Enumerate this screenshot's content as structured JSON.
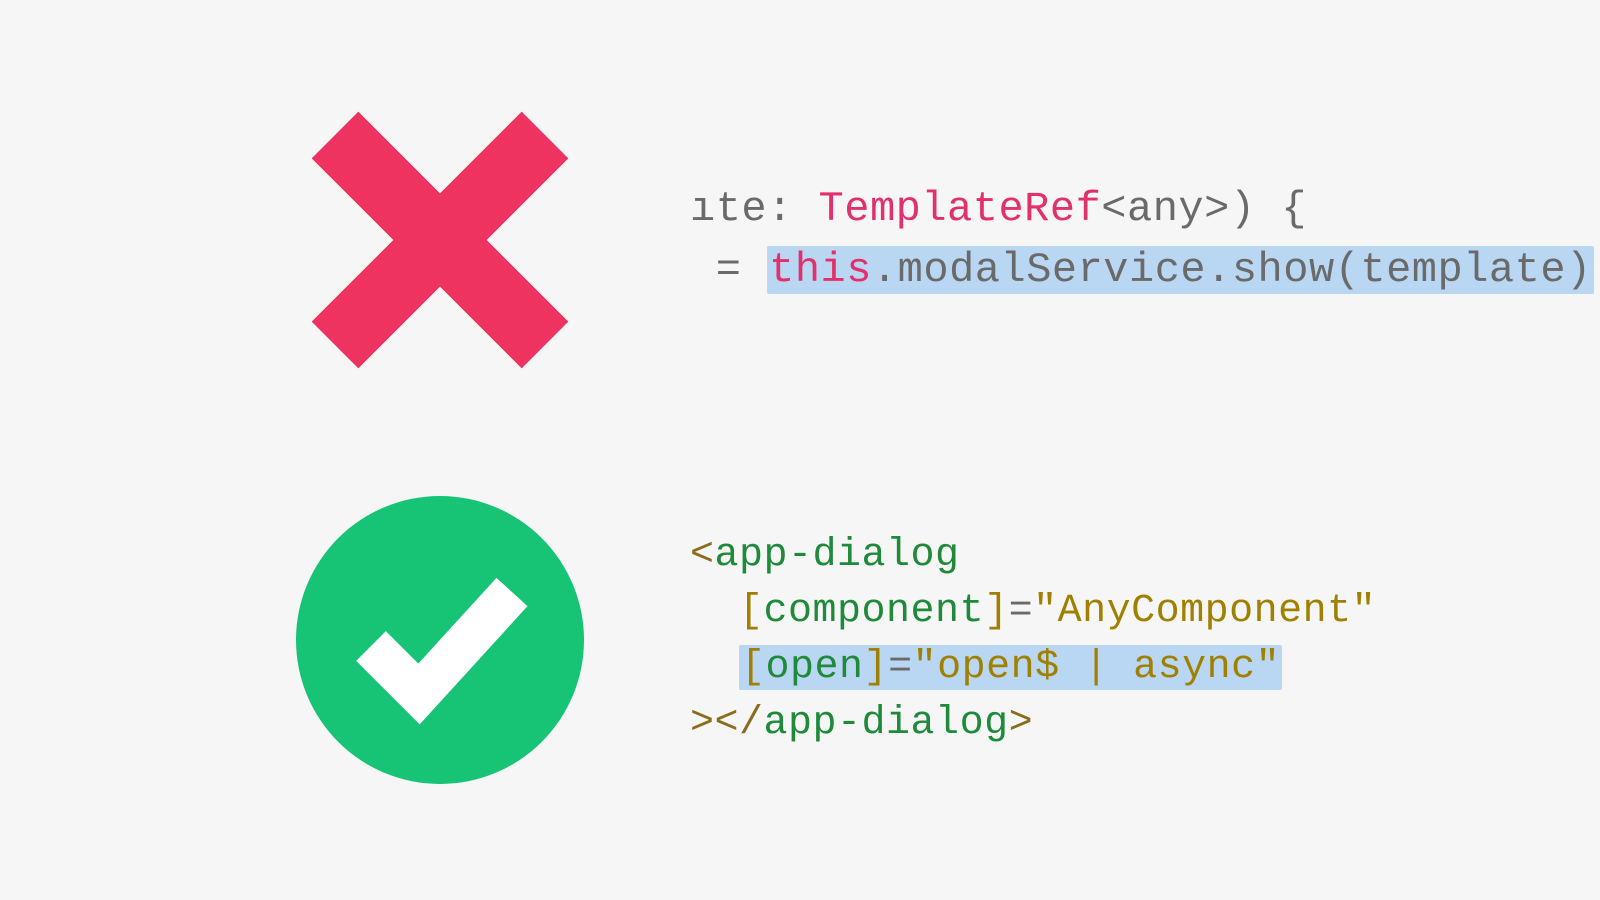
{
  "colors": {
    "cross": "#ef3360",
    "check": "#17c374",
    "highlight": "#b9d7f3"
  },
  "icons": {
    "bad": "cross-icon",
    "good": "checkmark-circle-icon"
  },
  "bad_example": {
    "line1": {
      "prefix": "ıte: ",
      "type": "TemplateRef",
      "generic_open": "<",
      "generic_param": "any",
      "generic_close": ">",
      "suffix": ") {"
    },
    "line2": {
      "prefix": " = ",
      "highlighted": {
        "this": "this",
        "dot1": ".",
        "obj": "modalService",
        "dot2": ".",
        "method": "show",
        "paren_open": "(",
        "arg": "template",
        "paren_close": ")"
      }
    }
  },
  "good_example": {
    "line1": {
      "open": "<",
      "tag": "app-dialog"
    },
    "line2": {
      "indent": "  ",
      "lbrack": "[",
      "attr": "component",
      "rbrack": "]",
      "eq": "=",
      "value": "\"AnyComponent\""
    },
    "line3": {
      "indent": "  ",
      "highlighted": {
        "lbrack": "[",
        "attr": "open",
        "rbrack": "]",
        "eq": "=",
        "value": "\"open$ | async\""
      }
    },
    "line4": {
      "close_open": ">",
      "end_open": "</",
      "tag": "app-dialog",
      "end_close": ">"
    }
  }
}
